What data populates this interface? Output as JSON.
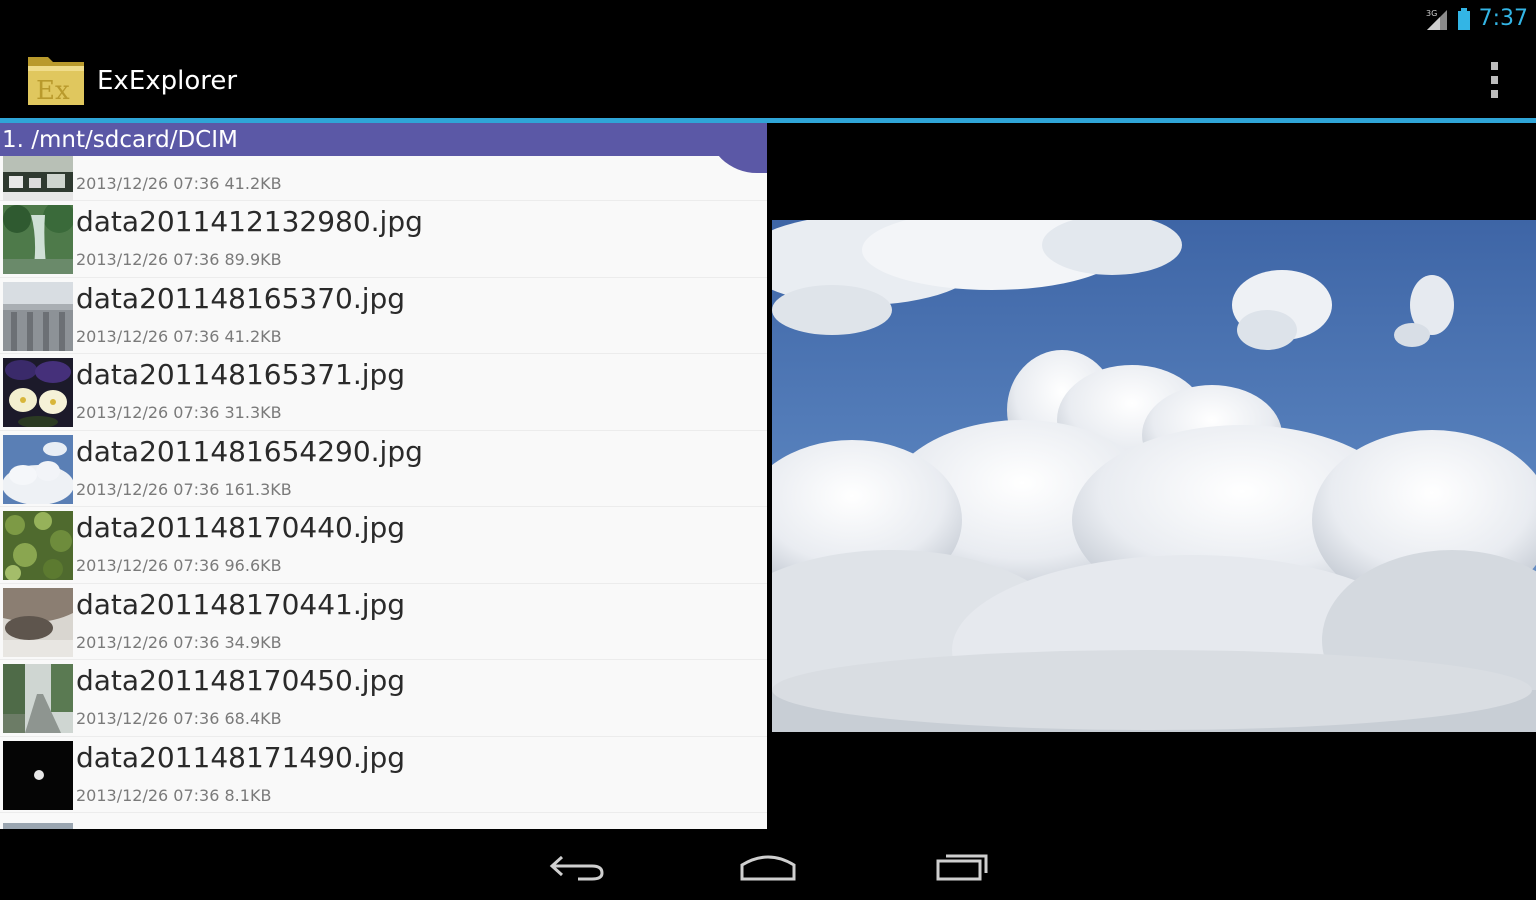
{
  "status_bar": {
    "network_label": "3G",
    "time": "7:37",
    "clock_color": "#33b5e5",
    "icons": [
      "signal-icon",
      "battery-icon"
    ]
  },
  "action_bar": {
    "app_icon_text": "Ex",
    "title": "ExExplorer",
    "overflow_icon": "overflow-menu-icon"
  },
  "accent_color": "#2fa5d7",
  "file_list": {
    "path": "1. /mnt/sdcard/DCIM",
    "header_color": "#5b58a6",
    "partial_top_item": {
      "meta": "2013/12/26 07:36  41.2KB",
      "thumb": "city-photo"
    },
    "items": [
      {
        "name": "data2011412132980.jpg",
        "meta": "2013/12/26 07:36  89.9KB",
        "thumb": "waterfall-photo"
      },
      {
        "name": "data201148165370.jpg",
        "meta": "2013/12/26 07:36  41.2KB",
        "thumb": "building-photo"
      },
      {
        "name": "data201148165371.jpg",
        "meta": "2013/12/26 07:36  31.3KB",
        "thumb": "flowers-photo"
      },
      {
        "name": "data2011481654290.jpg",
        "meta": "2013/12/26 07:36  161.3KB",
        "thumb": "clouds-photo"
      },
      {
        "name": "data201148170440.jpg",
        "meta": "2013/12/26 07:36  96.6KB",
        "thumb": "leaves-photo"
      },
      {
        "name": "data201148170441.jpg",
        "meta": "2013/12/26 07:36  34.9KB",
        "thumb": "cat-photo"
      },
      {
        "name": "data201148170450.jpg",
        "meta": "2013/12/26 07:36  68.4KB",
        "thumb": "road-photo"
      },
      {
        "name": "data201148171490.jpg",
        "meta": "2013/12/26 07:36  8.1KB",
        "thumb": "moon-photo"
      }
    ]
  },
  "preview": {
    "image": "clouds-sky-photo"
  },
  "nav_bar": {
    "icons": [
      "back-icon",
      "home-icon",
      "recent-apps-icon"
    ]
  }
}
